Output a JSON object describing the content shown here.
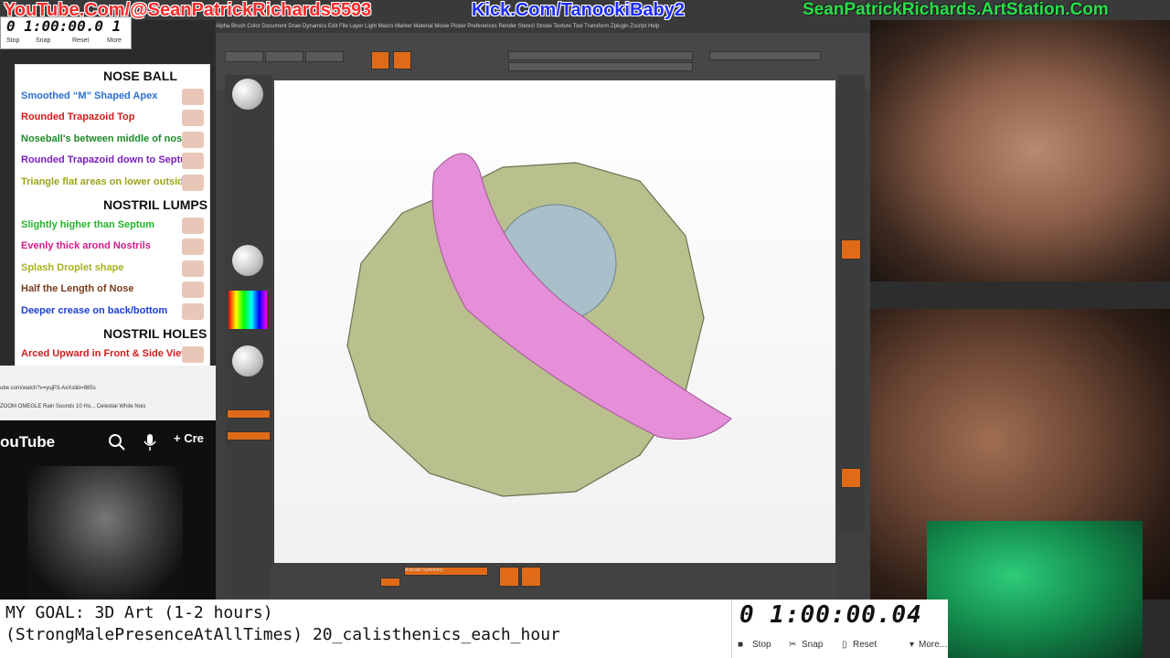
{
  "banner": {
    "youtube": "YouTube.Com/@SeanPatrickRichards5593",
    "kick": "Kick.Com/TanookiBaby2",
    "artstation": "SeanPatrickRichards.ArtStation.Com"
  },
  "timer_small": {
    "time": "0 1:00:00.0 1",
    "stop": "Stop",
    "snap": "Snap",
    "reset": "Reset",
    "more": "More"
  },
  "nose_panel": {
    "items": [
      {
        "label": "NOSE BALL",
        "color": "#111111",
        "head": true
      },
      {
        "label": "Smoothed “M” Shaped Apex",
        "color": "#2a6fd0"
      },
      {
        "label": "Rounded Trapazoid Top",
        "color": "#d01b1b"
      },
      {
        "label": "Noseball's between middle of nostrils",
        "color": "#1f8a2a"
      },
      {
        "label": "Rounded Trapazoid down to Septum",
        "color": "#7a1fc0"
      },
      {
        "label": "Triangle flat areas on lower outsides",
        "color": "#9aa51b"
      },
      {
        "label": "NOSTRIL LUMPS",
        "color": "#111111",
        "head": true
      },
      {
        "label": "Slightly higher than Septum",
        "color": "#25b32a"
      },
      {
        "label": "Evenly thick arond Nostrils",
        "color": "#d01b8a"
      },
      {
        "label": "Splash Droplet shape",
        "color": "#a6b31e"
      },
      {
        "label": "Half the Length of Nose",
        "color": "#7a3a1a"
      },
      {
        "label": "Deeper crease on back/bottom",
        "color": "#1a3fd0"
      },
      {
        "label": "NOSTRIL HOLES",
        "color": "#111111",
        "head": true
      },
      {
        "label": "Arced Upward in Front & Side View",
        "color": "#d01b1b"
      }
    ]
  },
  "browser": {
    "url": "ube.com/watch?v=yujP3-AxXsl&t=885s",
    "bookmarks": "ZOOM   OMEGLE   Rain Sounds 10 Ho...   Celestial White Nois"
  },
  "youtube": {
    "logo": "ouTube",
    "create": "Cre"
  },
  "zbrush": {
    "menu": "Alpha  Brush  Color  Document  Draw  Dynamics  Edit  File  Layer  Light  Macro  Marker  Material  Movie  Picker  Preferences  Render  Stencil  Stroke  Texture  Tool  Transform  Zplugin  Zscript  Help",
    "bottom_label": "Activate Symmetry",
    "accent": "#e06a17"
  },
  "goal": {
    "line1": "MY GOAL: 3D Art (1-2 hours)",
    "line2": "(StrongMalePresenceAtAllTimes) 20_calisthenics_each_hour"
  },
  "timer_big": {
    "time": "0 1:00:00.04",
    "stop": "Stop",
    "snap": "Snap",
    "reset": "Reset",
    "more": "More..."
  }
}
